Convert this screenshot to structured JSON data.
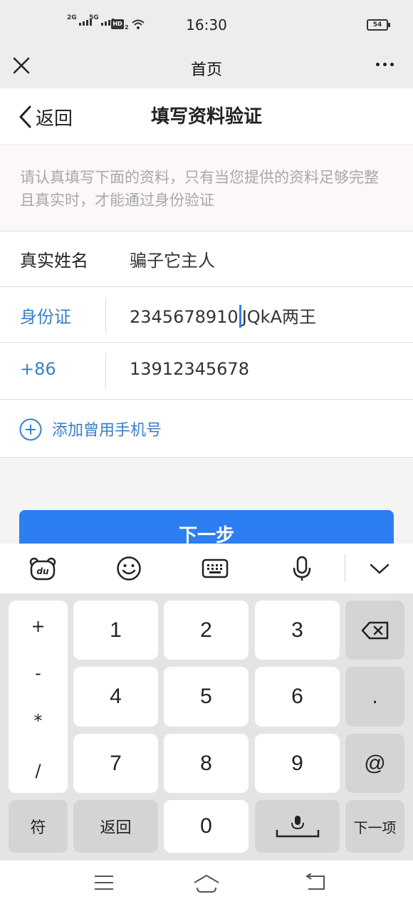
{
  "status": {
    "sim1": "2G",
    "sim2": "5G",
    "hd": "HD",
    "hd_sub": "2",
    "time": "16:30",
    "battery": "54"
  },
  "header": {
    "title": "首页"
  },
  "pagenav": {
    "back_label": "返回",
    "title": "填写资料验证"
  },
  "notice": {
    "text": "请认真填写下面的资料，只有当您提供的资料足够完整且真实时，才能通过身份验证"
  },
  "form": {
    "name_label": "真实姓名",
    "name_value": "骗子它主人",
    "id_label": "身份证",
    "id_value_before": "2345678910",
    "id_value_after": "JQkA两王",
    "phone_prefix": "+86",
    "phone_value": "13912345678",
    "add_phone": "添加曾用手机号"
  },
  "next_button": "下一步",
  "keyboard": {
    "symbols": [
      "+",
      "-",
      "*",
      "/"
    ],
    "digits": [
      "1",
      "2",
      "3",
      "4",
      "5",
      "6",
      "7",
      "8",
      "9",
      "0"
    ],
    "dot": ".",
    "at": "@",
    "sym_key": "符",
    "back_key": "返回",
    "next_key": "下一项"
  }
}
